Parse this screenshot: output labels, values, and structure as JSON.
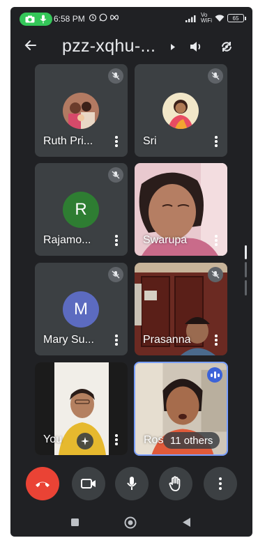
{
  "status": {
    "time": "6:58 PM",
    "signal_label": "Vo WiFi",
    "battery": "65"
  },
  "header": {
    "title": "pzz-xqhu-...",
    "icons": [
      "back-arrow-icon",
      "caret-right-icon",
      "speaker-icon",
      "switch-camera-icon"
    ]
  },
  "tiles": [
    {
      "name": "Ruth Pri...",
      "kind": "photo",
      "muted": true
    },
    {
      "name": "Sri",
      "kind": "photo",
      "muted": true
    },
    {
      "name": "Rajamo...",
      "kind": "letter",
      "letter": "R",
      "color": "#2e7d32",
      "muted": true
    },
    {
      "name": "Swarupa",
      "kind": "video",
      "muted": false
    },
    {
      "name": "Mary Su...",
      "kind": "letter",
      "letter": "M",
      "color": "#5c6bc0",
      "muted": true
    },
    {
      "name": "Prasanna",
      "kind": "video",
      "muted": true
    },
    {
      "name": "You",
      "kind": "video",
      "muted": false
    },
    {
      "name": "Ros",
      "kind": "video",
      "muted": false,
      "speaking": true,
      "others": "11 others"
    }
  ],
  "controls": [
    "end-call-icon",
    "camera-icon",
    "microphone-icon",
    "raise-hand-icon",
    "more-options-icon"
  ],
  "colors": {
    "background": "#202124",
    "tile": "#3c4043",
    "end_call": "#ea4335",
    "accent": "#7aa0ff"
  }
}
